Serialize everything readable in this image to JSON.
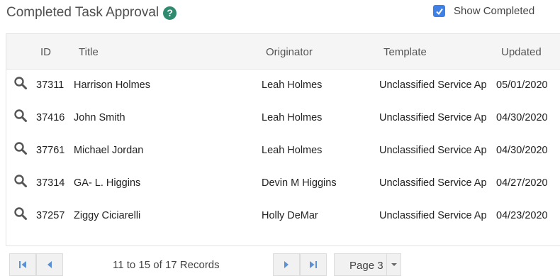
{
  "header": {
    "title": "Completed Task Approval",
    "help_icon": "question-circle-icon",
    "show_completed_label": "Show Completed",
    "show_completed_checked": true
  },
  "table": {
    "columns": [
      "ID",
      "Title",
      "Originator",
      "Template",
      "Updated"
    ],
    "rows": [
      {
        "id": "37311",
        "title": "Harrison Holmes",
        "originator": "Leah Holmes",
        "template": "Unclassified Service Ap",
        "updated": "05/01/2020"
      },
      {
        "id": "37416",
        "title": "John Smith",
        "originator": "Leah Holmes",
        "template": "Unclassified Service Ap",
        "updated": "04/30/2020"
      },
      {
        "id": "37761",
        "title": "Michael Jordan",
        "originator": "Leah Holmes",
        "template": "Unclassified Service Ap",
        "updated": "04/30/2020"
      },
      {
        "id": "37314",
        "title": "GA- L. Higgins",
        "originator": "Devin M Higgins",
        "template": "Unclassified Service Ap",
        "updated": "04/27/2020"
      },
      {
        "id": "37257",
        "title": "Ziggy Ciciarelli",
        "originator": "Holly DeMar",
        "template": "Unclassified Service Ap",
        "updated": "04/23/2020"
      }
    ]
  },
  "pager": {
    "records_text": "11 to 15 of 17 Records",
    "page_label": "Page 3"
  },
  "colors": {
    "accent": "#3f80e6",
    "help": "#2e8b6f",
    "pager_icon": "#5b8fd6"
  }
}
